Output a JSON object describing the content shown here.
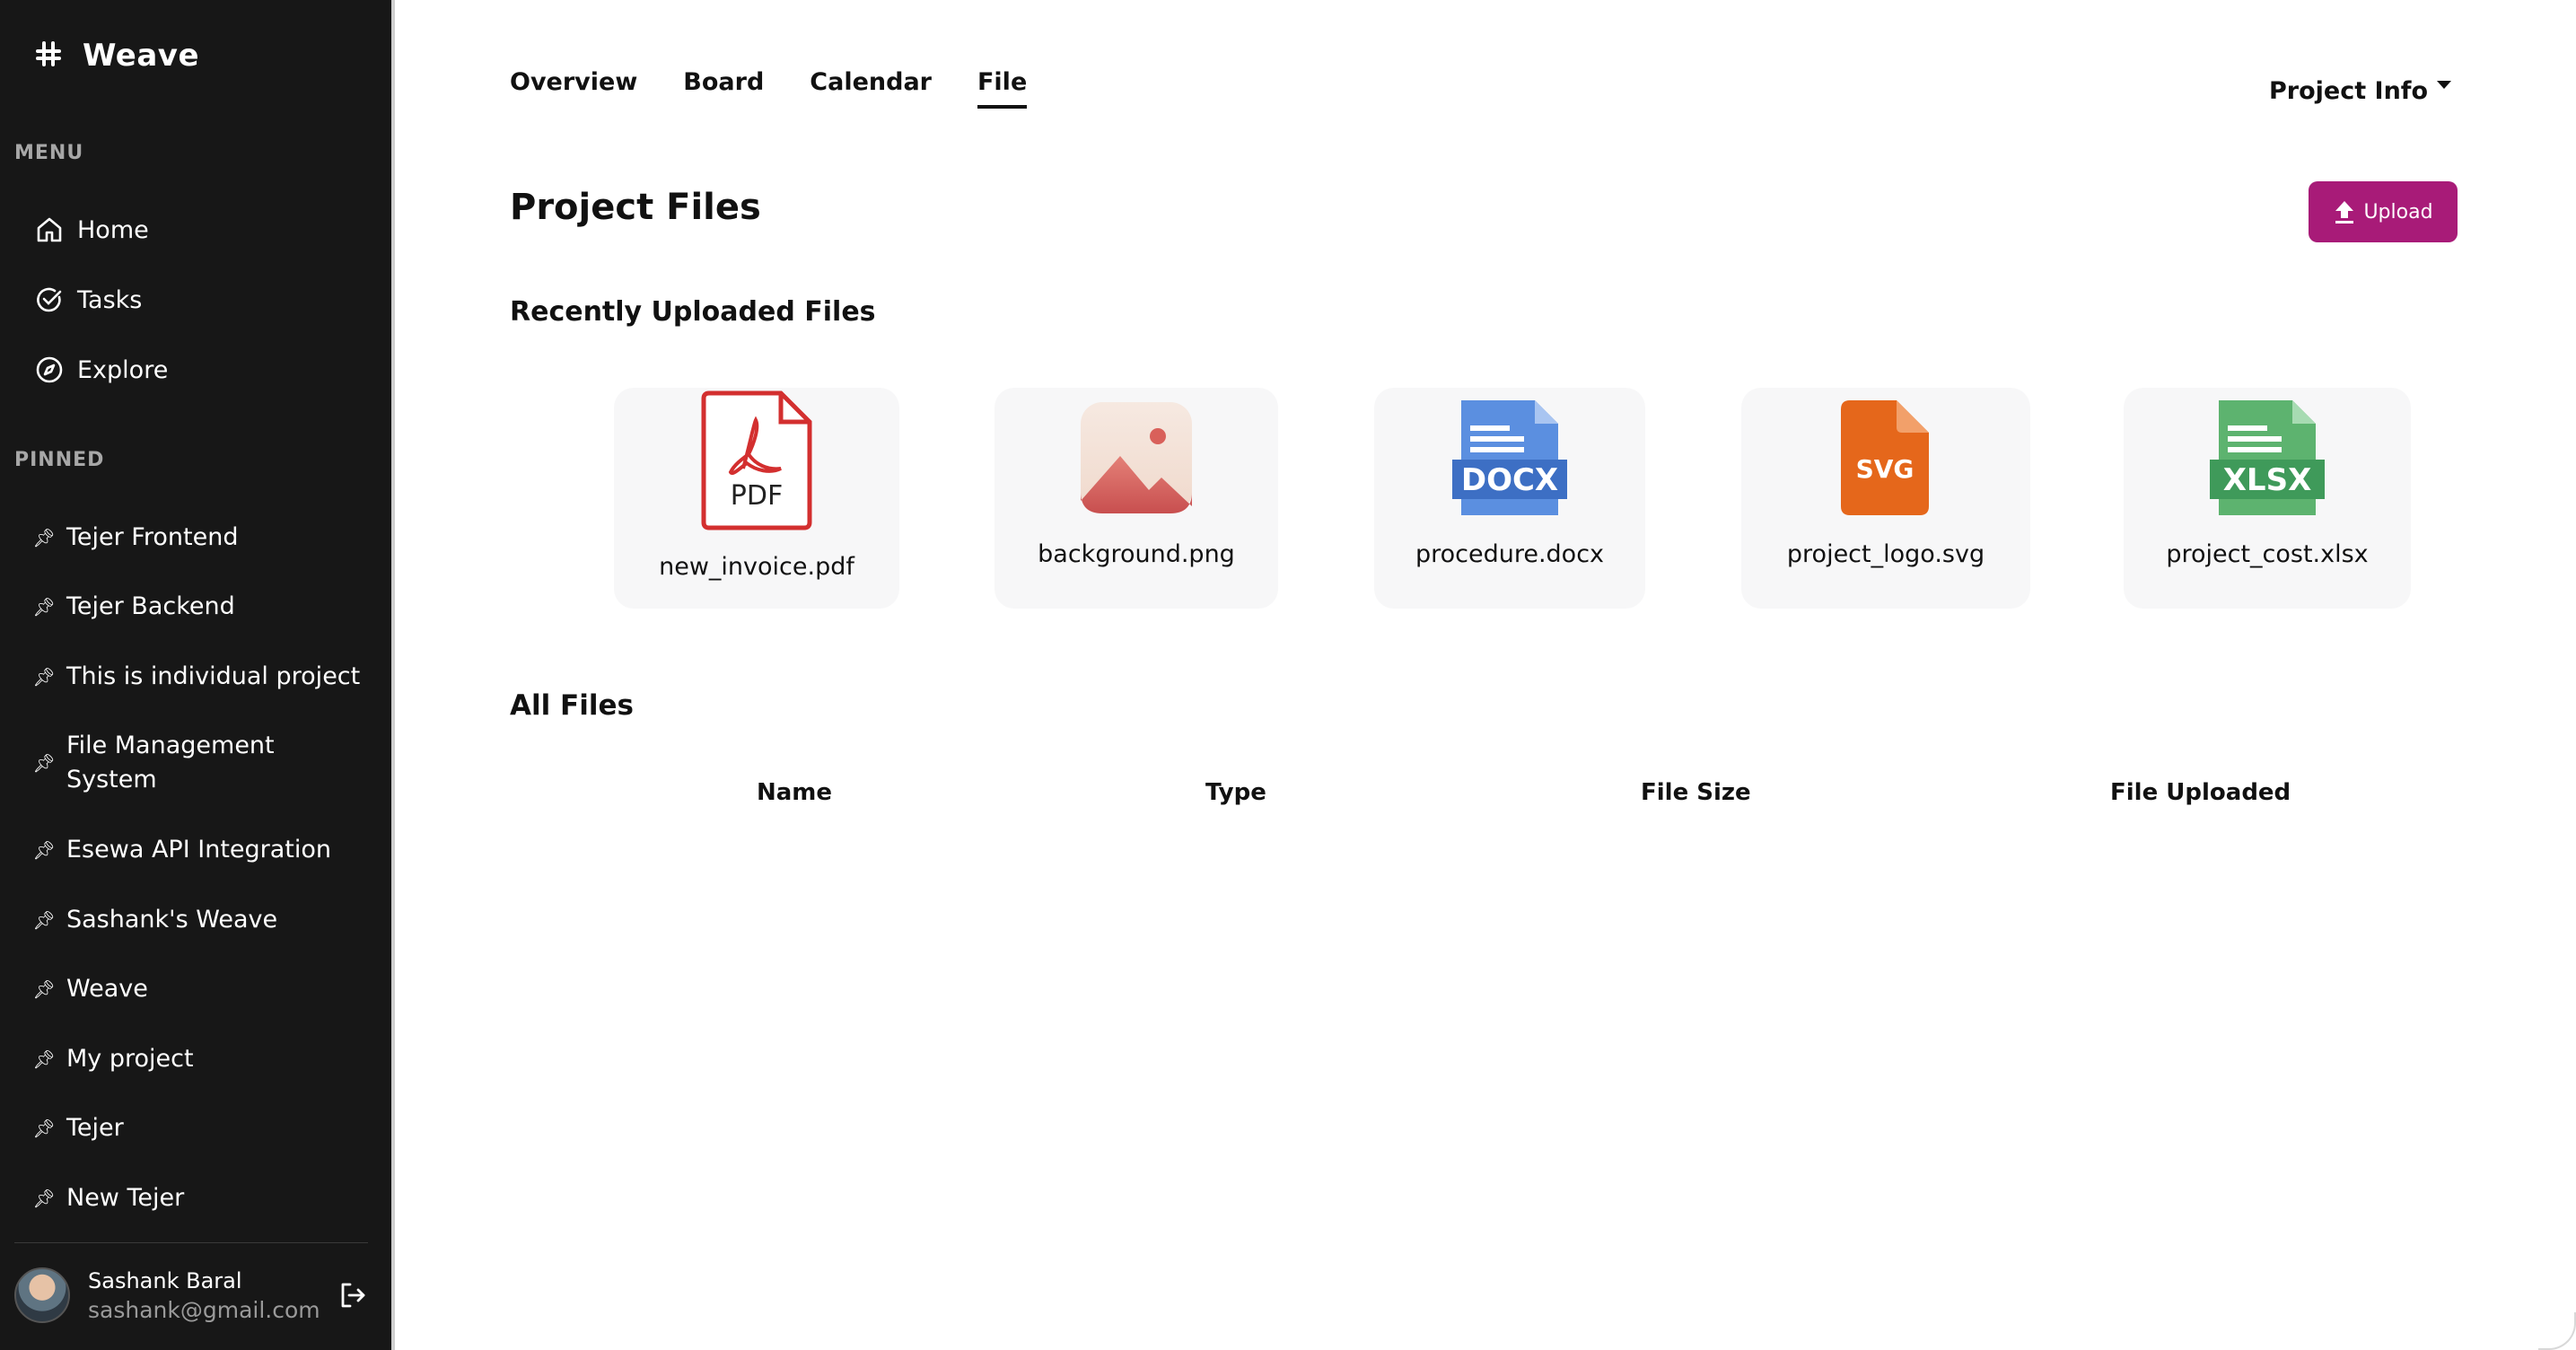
{
  "brand": {
    "name": "Weave"
  },
  "sidebar": {
    "menu_label": "MENU",
    "menu": [
      {
        "label": "Home",
        "icon": "home-icon"
      },
      {
        "label": "Tasks",
        "icon": "check-circle-icon"
      },
      {
        "label": "Explore",
        "icon": "compass-icon"
      }
    ],
    "pinned_label": "PINNED",
    "pinned": [
      "Tejer Frontend",
      "Tejer Backend",
      "This is individual project",
      "File Management System",
      "Esewa API Integration",
      "Sashank's Weave",
      "Weave",
      "My project",
      "Tejer",
      "New Tejer"
    ],
    "user": {
      "name": "Sashank Baral",
      "email": "sashank@gmail.com"
    }
  },
  "tabs": [
    {
      "label": "Overview",
      "active": false
    },
    {
      "label": "Board",
      "active": false
    },
    {
      "label": "Calendar",
      "active": false
    },
    {
      "label": "File",
      "active": true
    }
  ],
  "project_info": "Project Info",
  "page_title": "Project Files",
  "upload_label": "Upload",
  "recent_title": "Recently Uploaded Files",
  "recent_files": [
    {
      "name": "new_invoice.pdf",
      "type_badge": "PDF",
      "icon": "pdf-file-icon"
    },
    {
      "name": "background.png",
      "type_badge": "",
      "icon": "image-file-icon"
    },
    {
      "name": "procedure.docx",
      "type_badge": "DOCX",
      "icon": "docx-file-icon"
    },
    {
      "name": "project_logo.svg",
      "type_badge": "SVG",
      "icon": "svg-file-icon"
    },
    {
      "name": "project_cost.xlsx",
      "type_badge": "XLSX",
      "icon": "xlsx-file-icon"
    }
  ],
  "all_files_title": "All Files",
  "table_headers": [
    "Name",
    "Type",
    "File Size",
    "File Uploaded"
  ],
  "colors": {
    "sidebar_bg": "#171717",
    "accent": "#a81b78",
    "pdf": "#d32f2f",
    "docx": "#4a7fd4",
    "svg": "#e5671b",
    "xlsx": "#3f9a5a"
  }
}
